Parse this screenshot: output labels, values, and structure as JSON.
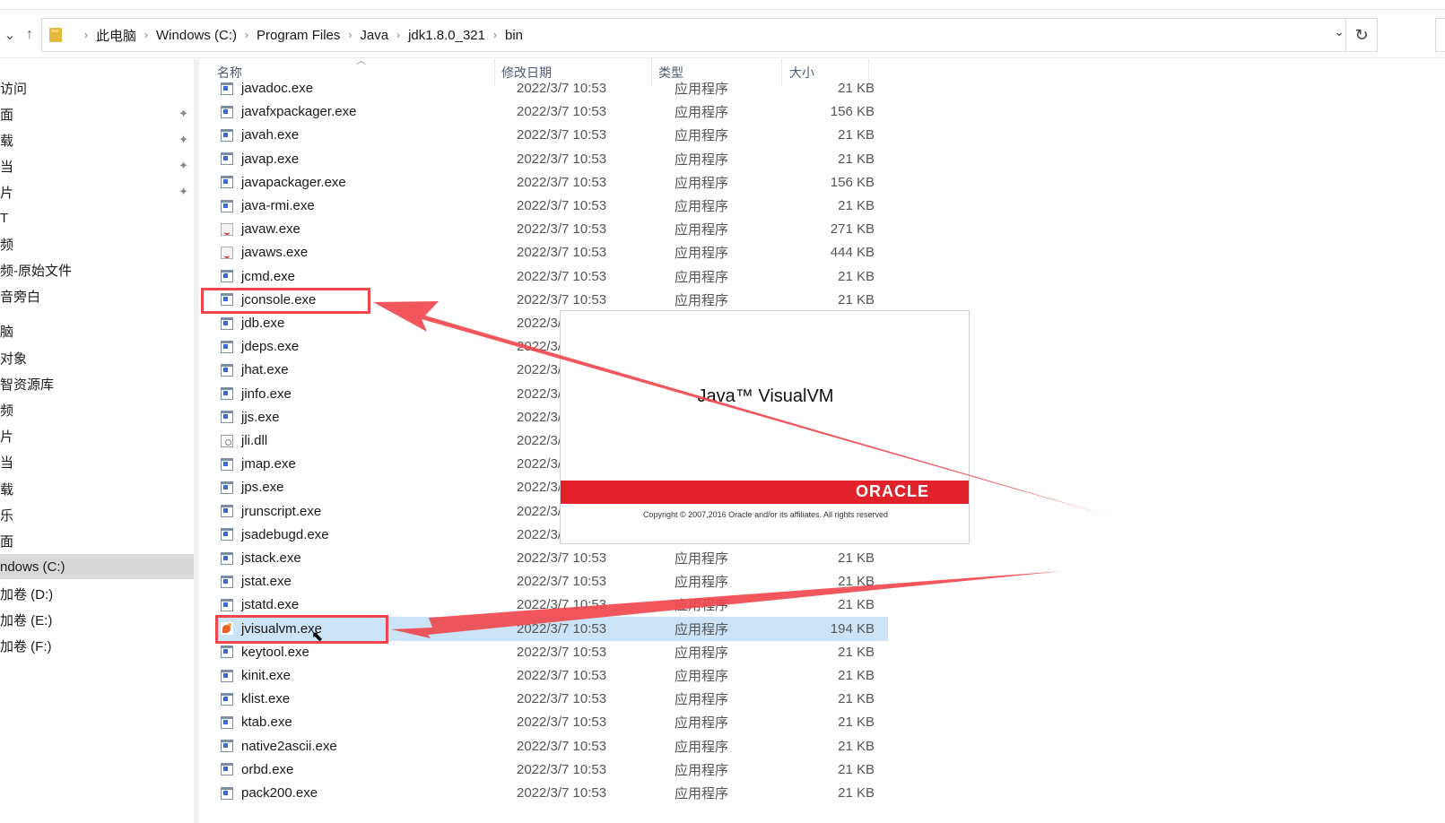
{
  "breadcrumbs": [
    "此电脑",
    "Windows (C:)",
    "Program Files",
    "Java",
    "jdk1.8.0_321",
    "bin"
  ],
  "nav_icons": [
    "chevron-down-icon",
    "up-arrow-icon"
  ],
  "sidebar": {
    "items": [
      {
        "label": "访问",
        "pinned": false
      },
      {
        "label": "面",
        "pinned": true
      },
      {
        "label": "载",
        "pinned": true
      },
      {
        "label": "当",
        "pinned": true
      },
      {
        "label": "片",
        "pinned": true
      },
      {
        "label": "T",
        "pinned": false
      },
      {
        "label": "频",
        "pinned": false
      },
      {
        "label": "频-原始文件",
        "pinned": false
      },
      {
        "label": "音旁白",
        "pinned": false
      },
      {
        "label": "脑",
        "pinned": false
      },
      {
        "label": "对象",
        "pinned": false
      },
      {
        "label": "智资源库",
        "pinned": false
      },
      {
        "label": "频",
        "pinned": false
      },
      {
        "label": "片",
        "pinned": false
      },
      {
        "label": "当",
        "pinned": false
      },
      {
        "label": "载",
        "pinned": false
      },
      {
        "label": "乐",
        "pinned": false
      },
      {
        "label": "面",
        "pinned": false
      },
      {
        "label": "ndows (C:)",
        "pinned": false,
        "selected": true
      },
      {
        "label": "加卷 (D:)",
        "pinned": false
      },
      {
        "label": "加卷 (E:)",
        "pinned": false
      },
      {
        "label": "加卷 (F:)",
        "pinned": false
      }
    ]
  },
  "columns": {
    "name": "名称",
    "date": "修改日期",
    "type": "类型",
    "size": "大小"
  },
  "files": [
    {
      "name": "javadoc.exe",
      "date": "2022/3/7 10:53",
      "type": "应用程序",
      "size": "21 KB",
      "icon": "exe"
    },
    {
      "name": "javafxpackager.exe",
      "date": "2022/3/7 10:53",
      "type": "应用程序",
      "size": "156 KB",
      "icon": "exe"
    },
    {
      "name": "javah.exe",
      "date": "2022/3/7 10:53",
      "type": "应用程序",
      "size": "21 KB",
      "icon": "exe"
    },
    {
      "name": "javap.exe",
      "date": "2022/3/7 10:53",
      "type": "应用程序",
      "size": "21 KB",
      "icon": "exe"
    },
    {
      "name": "javapackager.exe",
      "date": "2022/3/7 10:53",
      "type": "应用程序",
      "size": "156 KB",
      "icon": "exe"
    },
    {
      "name": "java-rmi.exe",
      "date": "2022/3/7 10:53",
      "type": "应用程序",
      "size": "21 KB",
      "icon": "exe"
    },
    {
      "name": "javaw.exe",
      "date": "2022/3/7 10:53",
      "type": "应用程序",
      "size": "271 KB",
      "icon": "java"
    },
    {
      "name": "javaws.exe",
      "date": "2022/3/7 10:53",
      "type": "应用程序",
      "size": "444 KB",
      "icon": "java"
    },
    {
      "name": "jcmd.exe",
      "date": "2022/3/7 10:53",
      "type": "应用程序",
      "size": "21 KB",
      "icon": "exe"
    },
    {
      "name": "jconsole.exe",
      "date": "2022/3/7 10:53",
      "type": "应用程序",
      "size": "21 KB",
      "icon": "exe"
    },
    {
      "name": "jdb.exe",
      "date": "2022/3/7",
      "type": "",
      "size": "",
      "icon": "exe"
    },
    {
      "name": "jdeps.exe",
      "date": "2022/3/7",
      "type": "",
      "size": "",
      "icon": "exe"
    },
    {
      "name": "jhat.exe",
      "date": "2022/3/7",
      "type": "",
      "size": "",
      "icon": "exe"
    },
    {
      "name": "jinfo.exe",
      "date": "2022/3/7",
      "type": "",
      "size": "",
      "icon": "exe"
    },
    {
      "name": "jjs.exe",
      "date": "2022/3/7",
      "type": "",
      "size": "",
      "icon": "exe"
    },
    {
      "name": "jli.dll",
      "date": "2022/3/7",
      "type": "",
      "size": "",
      "icon": "dll"
    },
    {
      "name": "jmap.exe",
      "date": "2022/3/7",
      "type": "",
      "size": "",
      "icon": "exe"
    },
    {
      "name": "jps.exe",
      "date": "2022/3/7",
      "type": "",
      "size": "",
      "icon": "exe"
    },
    {
      "name": "jrunscript.exe",
      "date": "2022/3/7",
      "type": "",
      "size": "",
      "icon": "exe"
    },
    {
      "name": "jsadebugd.exe",
      "date": "2022/3/7",
      "type": "",
      "size": "",
      "icon": "exe"
    },
    {
      "name": "jstack.exe",
      "date": "2022/3/7 10:53",
      "type": "应用程序",
      "size": "21 KB",
      "icon": "exe"
    },
    {
      "name": "jstat.exe",
      "date": "2022/3/7 10:53",
      "type": "应用程序",
      "size": "21 KB",
      "icon": "exe"
    },
    {
      "name": "jstatd.exe",
      "date": "2022/3/7 10:53",
      "type": "应用程序",
      "size": "21 KB",
      "icon": "exe"
    },
    {
      "name": "jvisualvm.exe",
      "date": "2022/3/7 10:53",
      "type": "应用程序",
      "size": "194 KB",
      "icon": "jvm",
      "selected": true
    },
    {
      "name": "keytool.exe",
      "date": "2022/3/7 10:53",
      "type": "应用程序",
      "size": "21 KB",
      "icon": "exe"
    },
    {
      "name": "kinit.exe",
      "date": "2022/3/7 10:53",
      "type": "应用程序",
      "size": "21 KB",
      "icon": "exe"
    },
    {
      "name": "klist.exe",
      "date": "2022/3/7 10:53",
      "type": "应用程序",
      "size": "21 KB",
      "icon": "exe"
    },
    {
      "name": "ktab.exe",
      "date": "2022/3/7 10:53",
      "type": "应用程序",
      "size": "21 KB",
      "icon": "exe"
    },
    {
      "name": "native2ascii.exe",
      "date": "2022/3/7 10:53",
      "type": "应用程序",
      "size": "21 KB",
      "icon": "exe"
    },
    {
      "name": "orbd.exe",
      "date": "2022/3/7 10:53",
      "type": "应用程序",
      "size": "21 KB",
      "icon": "exe"
    },
    {
      "name": "pack200.exe",
      "date": "2022/3/7 10:53",
      "type": "应用程序",
      "size": "21 KB",
      "icon": "exe"
    }
  ],
  "splash": {
    "title": "Java™ VisualVM",
    "logo": "ORACLE",
    "copyright": "Copyright © 2007,2016 Oracle and/or its affiliates. All rights reserved"
  },
  "colors": {
    "accent": "#f0454a",
    "selection": "#cce4f7",
    "oracle_red": "#e1222b"
  }
}
